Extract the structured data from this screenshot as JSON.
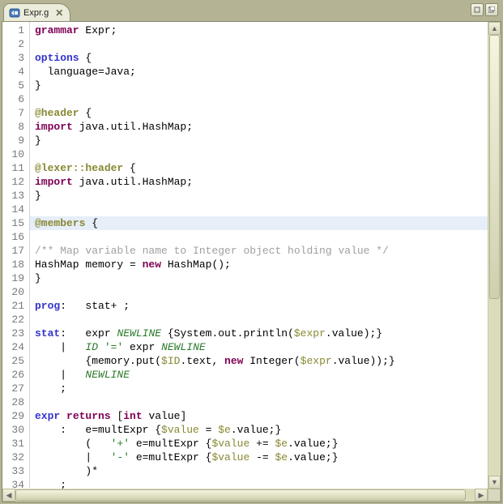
{
  "tab": {
    "title": "Expr.g"
  },
  "gutter": {
    "start": 1,
    "end": 34
  },
  "code": {
    "lines": [
      {
        "t": [
          [
            "kw",
            "grammar"
          ],
          [
            "",
            " Expr;"
          ]
        ]
      },
      {
        "t": [
          [
            "",
            ""
          ]
        ]
      },
      {
        "t": [
          [
            "rule",
            "options"
          ],
          [
            "",
            " {"
          ]
        ]
      },
      {
        "t": [
          [
            "",
            "  language=Java;"
          ]
        ]
      },
      {
        "t": [
          [
            "",
            "}"
          ]
        ]
      },
      {
        "t": [
          [
            "",
            ""
          ]
        ]
      },
      {
        "t": [
          [
            "ann",
            "@header"
          ],
          [
            "",
            " {"
          ]
        ]
      },
      {
        "t": [
          [
            "kw",
            "import"
          ],
          [
            "",
            " java.util.HashMap;"
          ]
        ]
      },
      {
        "t": [
          [
            "",
            "}"
          ]
        ]
      },
      {
        "t": [
          [
            "",
            ""
          ]
        ]
      },
      {
        "t": [
          [
            "ann",
            "@lexer::header"
          ],
          [
            "",
            " {"
          ]
        ]
      },
      {
        "t": [
          [
            "kw",
            "import"
          ],
          [
            "",
            " java.util.HashMap;"
          ]
        ]
      },
      {
        "t": [
          [
            "",
            "}"
          ]
        ]
      },
      {
        "t": [
          [
            "",
            ""
          ]
        ]
      },
      {
        "hl": true,
        "t": [
          [
            "ann",
            "@members"
          ],
          [
            "",
            " {"
          ]
        ]
      },
      {
        "t": [
          [
            "cmt",
            "/** Map variable name to Integer object holding value */"
          ]
        ]
      },
      {
        "t": [
          [
            "",
            "HashMap memory = "
          ],
          [
            "kw",
            "new"
          ],
          [
            "",
            " HashMap();"
          ]
        ]
      },
      {
        "t": [
          [
            "",
            "}"
          ]
        ]
      },
      {
        "t": [
          [
            "",
            ""
          ]
        ]
      },
      {
        "t": [
          [
            "rule",
            "prog"
          ],
          [
            "",
            ":   stat+ ;"
          ]
        ]
      },
      {
        "t": [
          [
            "",
            ""
          ]
        ]
      },
      {
        "t": [
          [
            "rule",
            "stat"
          ],
          [
            "",
            ":   expr "
          ],
          [
            "tok",
            "NEWLINE"
          ],
          [
            "",
            " {System.out.println("
          ],
          [
            "attr",
            "$expr"
          ],
          [
            "",
            ".value);}"
          ]
        ]
      },
      {
        "t": [
          [
            "",
            "    |   "
          ],
          [
            "tok",
            "ID"
          ],
          [
            "",
            " "
          ],
          [
            "str",
            "'='"
          ],
          [
            "",
            " expr "
          ],
          [
            "tok",
            "NEWLINE"
          ]
        ]
      },
      {
        "t": [
          [
            "",
            "        {memory.put("
          ],
          [
            "attr",
            "$ID"
          ],
          [
            "",
            ".text, "
          ],
          [
            "kw",
            "new"
          ],
          [
            "",
            " Integer("
          ],
          [
            "attr",
            "$expr"
          ],
          [
            "",
            ".value));}"
          ]
        ]
      },
      {
        "t": [
          [
            "",
            "    |   "
          ],
          [
            "tok",
            "NEWLINE"
          ]
        ]
      },
      {
        "t": [
          [
            "",
            "    ;"
          ]
        ]
      },
      {
        "t": [
          [
            "",
            ""
          ]
        ]
      },
      {
        "t": [
          [
            "rule",
            "expr"
          ],
          [
            "",
            " "
          ],
          [
            "kw",
            "returns"
          ],
          [
            "",
            " ["
          ],
          [
            "kw",
            "int"
          ],
          [
            "",
            " value]"
          ]
        ]
      },
      {
        "t": [
          [
            "",
            "    :   e=multExpr {"
          ],
          [
            "attr",
            "$value"
          ],
          [
            "",
            " = "
          ],
          [
            "attr",
            "$e"
          ],
          [
            "",
            ".value;}"
          ]
        ]
      },
      {
        "t": [
          [
            "",
            "        (   "
          ],
          [
            "str",
            "'+'"
          ],
          [
            "",
            " e=multExpr {"
          ],
          [
            "attr",
            "$value"
          ],
          [
            "",
            " += "
          ],
          [
            "attr",
            "$e"
          ],
          [
            "",
            ".value;}"
          ]
        ]
      },
      {
        "t": [
          [
            "",
            "        |   "
          ],
          [
            "str",
            "'-'"
          ],
          [
            "",
            " e=multExpr {"
          ],
          [
            "attr",
            "$value"
          ],
          [
            "",
            " -= "
          ],
          [
            "attr",
            "$e"
          ],
          [
            "",
            ".value;}"
          ]
        ]
      },
      {
        "t": [
          [
            "",
            "        )*"
          ]
        ]
      },
      {
        "t": [
          [
            "",
            "    ;"
          ]
        ]
      },
      {
        "t": [
          [
            "",
            ""
          ]
        ]
      }
    ]
  }
}
